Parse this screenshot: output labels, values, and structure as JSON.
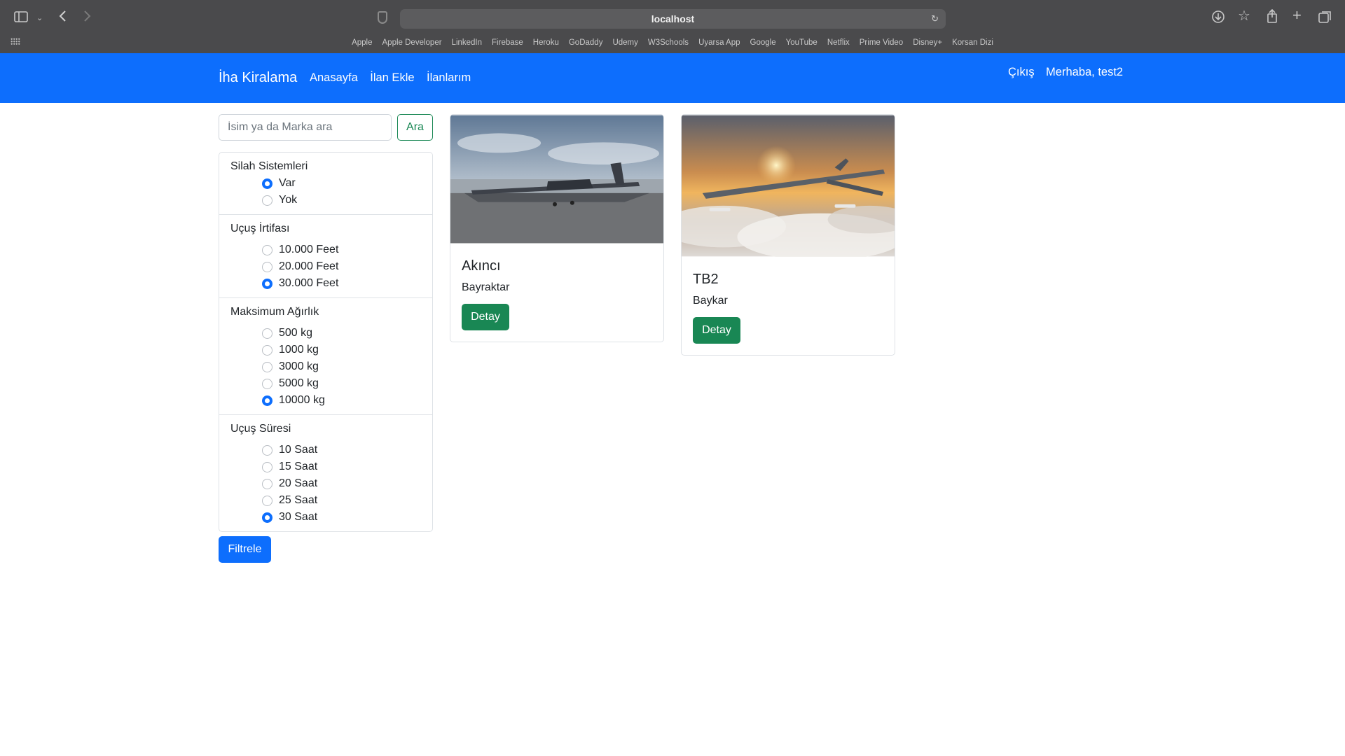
{
  "browser": {
    "url": "localhost",
    "bookmarks": [
      "Apple",
      "Apple Developer",
      "LinkedIn",
      "Firebase",
      "Heroku",
      "GoDaddy",
      "Udemy",
      "W3Schools",
      "Uyarsa App",
      "Google",
      "YouTube",
      "Netflix",
      "Prime Video",
      "Disney+",
      "Korsan Dizi"
    ]
  },
  "navbar": {
    "brand": "İha Kiralama",
    "links": [
      "Anasayfa",
      "İlan Ekle",
      "İlanlarım"
    ],
    "logout": "Çıkış",
    "greeting": "Merhaba, test2",
    "color": "#0d6efd"
  },
  "search": {
    "placeholder": "İsim ya da Marka ara",
    "button": "Ara"
  },
  "filters": [
    {
      "title": "Silah Sistemleri",
      "options": [
        "Var",
        "Yok"
      ],
      "selected": 0
    },
    {
      "title": "Uçuş İrtifası",
      "options": [
        "10.000 Feet",
        "20.000 Feet",
        "30.000 Feet"
      ],
      "selected": 2
    },
    {
      "title": "Maksimum Ağırlık",
      "options": [
        "500 kg",
        "1000 kg",
        "3000 kg",
        "5000 kg",
        "10000 kg"
      ],
      "selected": 4
    },
    {
      "title": "Uçuş Süresi",
      "options": [
        "10 Saat",
        "15 Saat",
        "20 Saat",
        "25 Saat",
        "30 Saat"
      ],
      "selected": 4
    }
  ],
  "filter_button": "Filtrele",
  "listings": [
    {
      "name": "Akıncı",
      "brand": "Bayraktar",
      "button": "Detay"
    },
    {
      "name": "TB2",
      "brand": "Baykar",
      "button": "Detay"
    }
  ]
}
